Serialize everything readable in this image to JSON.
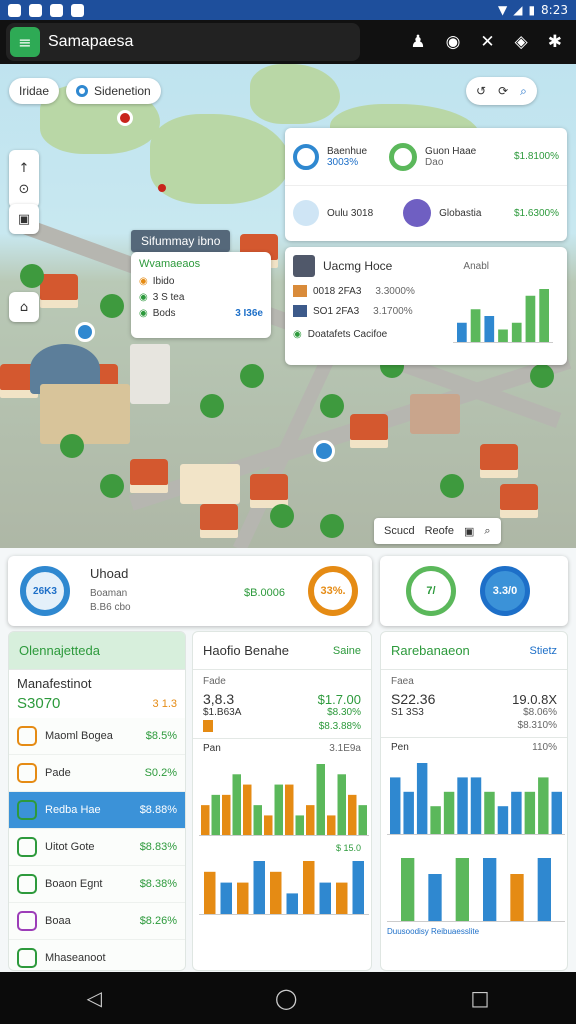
{
  "status_bar": {
    "time": "8:23"
  },
  "app_bar": {
    "title": "Samapaesa",
    "menu_icon": "≡",
    "actions": [
      "profile-icon",
      "gamepad-icon",
      "shuffle-icon",
      "shield-icon",
      "settings-icon"
    ]
  },
  "map": {
    "chip_left": "Iridae",
    "chip_loc": "Sidenetion",
    "top_right_icons": [
      "undo-icon",
      "refresh-icon",
      "search-icon"
    ],
    "side_tools": [
      "1",
      "⊙",
      "▣",
      "⌂"
    ],
    "region_label": "Sifummay ibno",
    "bottom_chip": {
      "a": "Scucd",
      "b": "Reofe"
    }
  },
  "map_popup": {
    "title": "Wvamaeaos",
    "rows": [
      {
        "label": "Ibido",
        "value": ""
      },
      {
        "label": "3 S tea",
        "value": ""
      },
      {
        "label": "Bods",
        "value": "3 I36e"
      }
    ]
  },
  "stats_card": {
    "rows": [
      {
        "name": "Baenhue",
        "sub": "3003%",
        "name2": "Guon Haae",
        "sub2": "Dao",
        "value": "$1.8100%"
      },
      {
        "name": "Oulu 3018",
        "sub": "",
        "name2": "Globastia",
        "sub2": "",
        "value": "$1.6300%"
      }
    ]
  },
  "user_card": {
    "title": "Uacmg Hoce",
    "chart_label": "Anabl",
    "rows": [
      {
        "label": "0018 2FA3",
        "value": "3.3000%"
      },
      {
        "label": "SO1 2FA3",
        "value": "3.1700%"
      }
    ],
    "footer": "Doatafets Cacifoe",
    "chart_data": {
      "type": "bar",
      "values": [
        3,
        5,
        4,
        2,
        3,
        7,
        8
      ],
      "colors": [
        "#2f88d0",
        "#5bb85b",
        "#2f88d0",
        "#5bb85b",
        "#5bb85b",
        "#5bb85b",
        "#5bb85b"
      ]
    }
  },
  "summary": {
    "ring1": "26K3",
    "title": "Uhoad",
    "sub1": "Boaman",
    "sub2": "B.B6 cbo",
    "mid_value": "$B.0006",
    "ring2": "33%.",
    "ring3": "7/",
    "ring4": "3.3/0"
  },
  "panel_left": {
    "header": "Olennajetteda",
    "title": "Manafestinot",
    "value": "S3070",
    "value_right": "3 1.3",
    "items": [
      {
        "label": "Maoml Bogea",
        "value": "$8.5%",
        "color": "#e58b14",
        "active": false
      },
      {
        "label": "Pade",
        "value": "S0.2%",
        "color": "#e58b14",
        "active": false
      },
      {
        "label": "Redba Hae",
        "value": "$8.88%",
        "color": "#2d9a3c",
        "active": true
      },
      {
        "label": "Uitot Gote",
        "value": "$8.83%",
        "color": "#2d9a3c",
        "active": false
      },
      {
        "label": "Boaon Egnt",
        "value": "$8.38%",
        "color": "#2d9a3c",
        "active": false
      },
      {
        "label": "Boaa",
        "value": "$8.26%",
        "color": "#9c3db8",
        "active": false
      },
      {
        "label": "Mhaseanoot",
        "value": "",
        "color": "#2d9a3c",
        "active": false
      }
    ]
  },
  "panel_mid": {
    "header": "Haofio Benahe",
    "tag": "Saine",
    "label1": "Fade",
    "value1": "3,8.3",
    "value1r": "$1.7.00",
    "label2": "$1.B63A",
    "value2r": "$8.30%",
    "value3r": "$8.3.88%",
    "chart_title": "Pan",
    "chart_note": "3.1E9a",
    "footer_note": "$ 15.0",
    "chart_data": {
      "type": "bar",
      "series": [
        {
          "name": "",
          "color": "#e58b14",
          "values": [
            3,
            4,
            5,
            2,
            5,
            3,
            2,
            4
          ]
        },
        {
          "name": "",
          "color": "#5bb85b",
          "values": [
            4,
            6,
            3,
            5,
            2,
            7,
            6,
            3
          ]
        }
      ],
      "series2": [
        {
          "color": "#e58b14",
          "values": [
            4,
            3,
            4,
            5,
            3
          ]
        },
        {
          "color": "#2f88d0",
          "values": [
            3,
            5,
            2,
            3,
            5
          ]
        }
      ]
    }
  },
  "panel_right": {
    "header": "Rarebanaeon",
    "tag": "Stietz",
    "label1": "Faea",
    "value1": "S22.36",
    "value1r": "19.0.8X",
    "label2": "S1 3S3",
    "value2r": "$8.06%",
    "value3r": "$8.310%",
    "chart_title": "Pen",
    "chart_note": "110%",
    "footer_note": "Duusoodisy Reibuaesslite",
    "chart_data": {
      "type": "bar",
      "values": [
        4,
        3,
        5,
        2,
        3,
        4,
        4,
        3,
        2,
        3,
        3,
        4,
        3
      ],
      "colors": [
        "#2f88d0",
        "#2f88d0",
        "#2f88d0",
        "#5bb85b",
        "#5bb85b",
        "#2f88d0",
        "#2f88d0",
        "#5bb85b",
        "#2f88d0",
        "#2f88d0",
        "#5bb85b",
        "#5bb85b",
        "#2f88d0"
      ],
      "values2": [
        4,
        3,
        4,
        4,
        3,
        4
      ],
      "colors2": [
        "#5bb85b",
        "#2f88d0",
        "#5bb85b",
        "#2f88d0",
        "#e58b14",
        "#2f88d0"
      ]
    }
  },
  "nav": {
    "back": "◁",
    "home": "◯",
    "recent": "□"
  }
}
